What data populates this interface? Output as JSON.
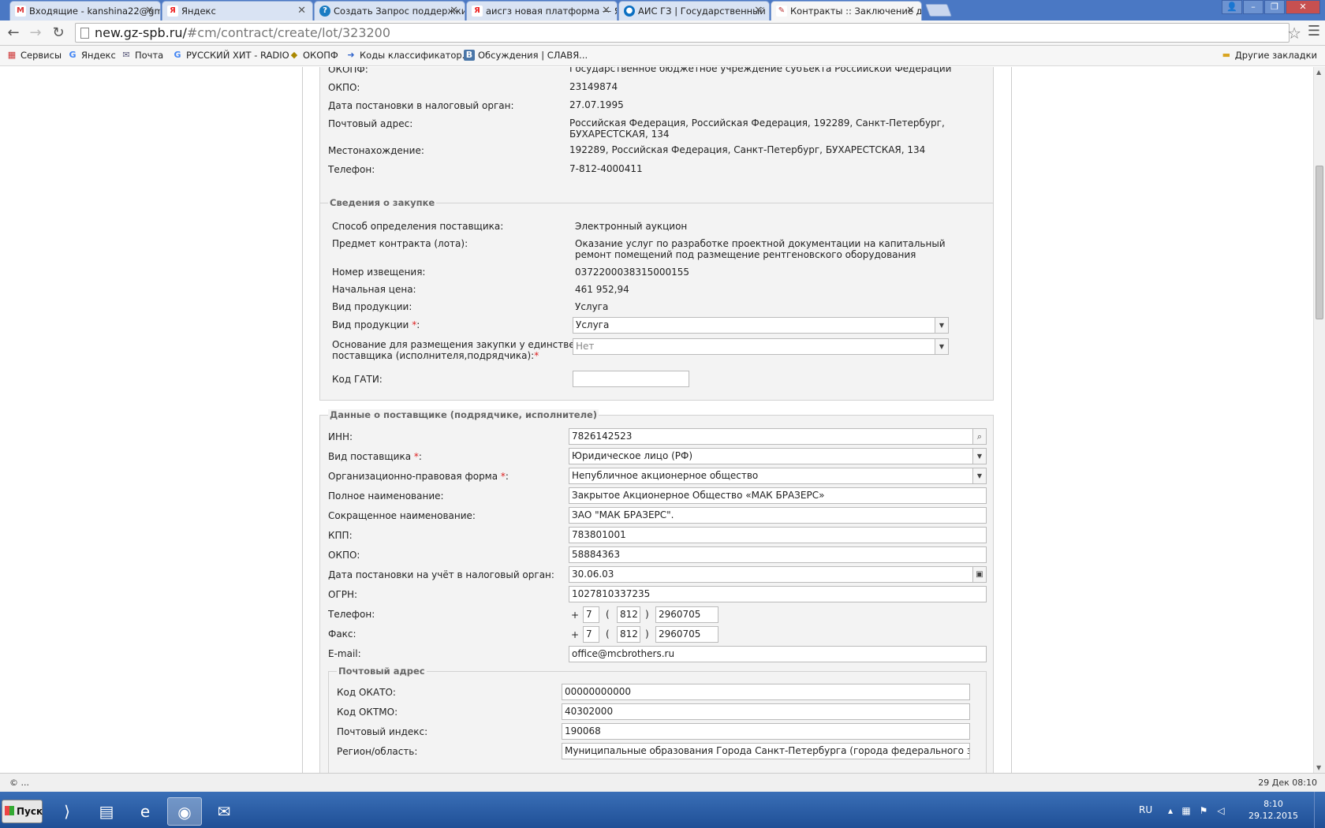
{
  "tabs": [
    {
      "title": "Входящие - kanshina22@gm",
      "fav": "M",
      "color": "#d33"
    },
    {
      "title": "Яндекс",
      "fav": "Я",
      "color": "#e22"
    },
    {
      "title": "Создать Запрос поддержки",
      "fav": "?",
      "color": "#1a7cc2"
    },
    {
      "title": "аисгз новая платформа — Я",
      "fav": "Я",
      "color": "#e22"
    },
    {
      "title": "АИС ГЗ | Государственный",
      "fav": "●",
      "color": "#0a6fc2"
    },
    {
      "title": "Контракты :: Заключение д",
      "fav": "✎",
      "color": "#b33"
    }
  ],
  "address": {
    "host": "new.gz-spb.ru/",
    "path": "#cm/contract/create/lot/323200"
  },
  "bookmarks": [
    {
      "label": "Сервисы",
      "icon": "apps-icon"
    },
    {
      "label": "Яндекс",
      "icon": "google-icon"
    },
    {
      "label": "Почта",
      "icon": "mail-icon"
    },
    {
      "label": "РУССКИЙ ХИТ - RADIO",
      "icon": "google-icon"
    },
    {
      "label": "ОКОПФ",
      "icon": "bookmark-icon"
    },
    {
      "label": "Коды классификатор...",
      "icon": "arrow-icon"
    },
    {
      "label": "Обсуждения | СЛАВЯ...",
      "icon": "vk-icon"
    }
  ],
  "other_bookmarks": "Другие закладки",
  "customer": {
    "okopf_label": "ОКОПФ:",
    "okopf_value": "Государственное бюджетное учреждение субъекта Российской Федерации",
    "okpo_label": "ОКПО:",
    "okpo_value": "23149874",
    "tax_date_label": "Дата постановки в налоговый орган:",
    "tax_date_value": "27.07.1995",
    "postal_label": "Почтовый адрес:",
    "postal_value": "Российская Федерация, Российская Федерация, 192289, Санкт-Петербург, БУХАРЕСТСКАЯ, 134",
    "location_label": "Местонахождение:",
    "location_value": "192289, Российская Федерация, Санкт-Петербург, БУХАРЕСТСКАЯ, 134",
    "phone_label": "Телефон:",
    "phone_value": "7-812-4000411"
  },
  "purchase": {
    "legend": "Сведения о закупке",
    "method_label": "Способ определения поставщика:",
    "method_value": "Электронный аукцион",
    "subject_label": "Предмет контракта (лота):",
    "subject_value": "Оказание услуг по разработке проектной документации на капитальный ремонт помещений под размещение рентгеновского оборудования",
    "notice_label": "Номер извещения:",
    "notice_value": "0372200038315000155",
    "price_label": "Начальная цена:",
    "price_value": "461 952,94",
    "product_type_label": "Вид продукции:",
    "product_type_value": "Услуга",
    "product_type_req_label": "Вид продукции",
    "product_type_select": "Услуга",
    "sole_label_1": "Основание для размещения закупки у единственного",
    "sole_label_2": "поставщика (исполнителя,подрядчика):",
    "sole_select": "Нет",
    "gati_label": "Код ГАТИ:",
    "gati_value": ""
  },
  "supplier": {
    "legend": "Данные о поставщике (подрядчике, исполнителе)",
    "inn_label": "ИНН:",
    "inn_value": "7826142523",
    "kind_label": "Вид поставщика",
    "kind_value": "Юридическое лицо (РФ)",
    "opf_label": "Организационно-правовая форма",
    "opf_value": "Непубличное акционерное общество",
    "full_name_label": "Полное наименование:",
    "full_name_value": "Закрытое Акционерное Общество «МАК БРАЗЕРС»",
    "short_name_label": "Сокращенное наименование:",
    "short_name_value": "ЗАО \"МАК БРАЗЕРС\".",
    "kpp_label": "КПП:",
    "kpp_value": "783801001",
    "okpo_label": "ОКПО:",
    "okpo_value": "58884363",
    "tax_date_label": "Дата постановки на учёт в налоговый орган:",
    "tax_date_value": "30.06.03",
    "ogrn_label": "ОГРН:",
    "ogrn_value": "1027810337235",
    "phone_label": "Телефон:",
    "phone_country": "7",
    "phone_code": "812",
    "phone_number": "2960705",
    "fax_label": "Факс:",
    "fax_country": "7",
    "fax_code": "812",
    "fax_number": "2960705",
    "email_label": "E-mail:",
    "email_value": "office@mcbrothers.ru"
  },
  "postal": {
    "legend": "Почтовый адрес",
    "okato_label": "Код ОКАТО:",
    "okato_value": "00000000000",
    "oktmo_label": "Код ОКТМО:",
    "oktmo_value": "40302000",
    "index_label": "Почтовый индекс:",
    "index_value": "190068",
    "region_label": "Регион/область:",
    "region_value": "Муниципальные образования Города Санкт-Петербурга (города федерального значения)"
  },
  "statusbar": {
    "left": "© ...",
    "right": "29 Дек 08:10"
  },
  "taskbar": {
    "start": "Пуск",
    "lang": "RU",
    "time": "8:10",
    "date": "29.12.2015"
  }
}
